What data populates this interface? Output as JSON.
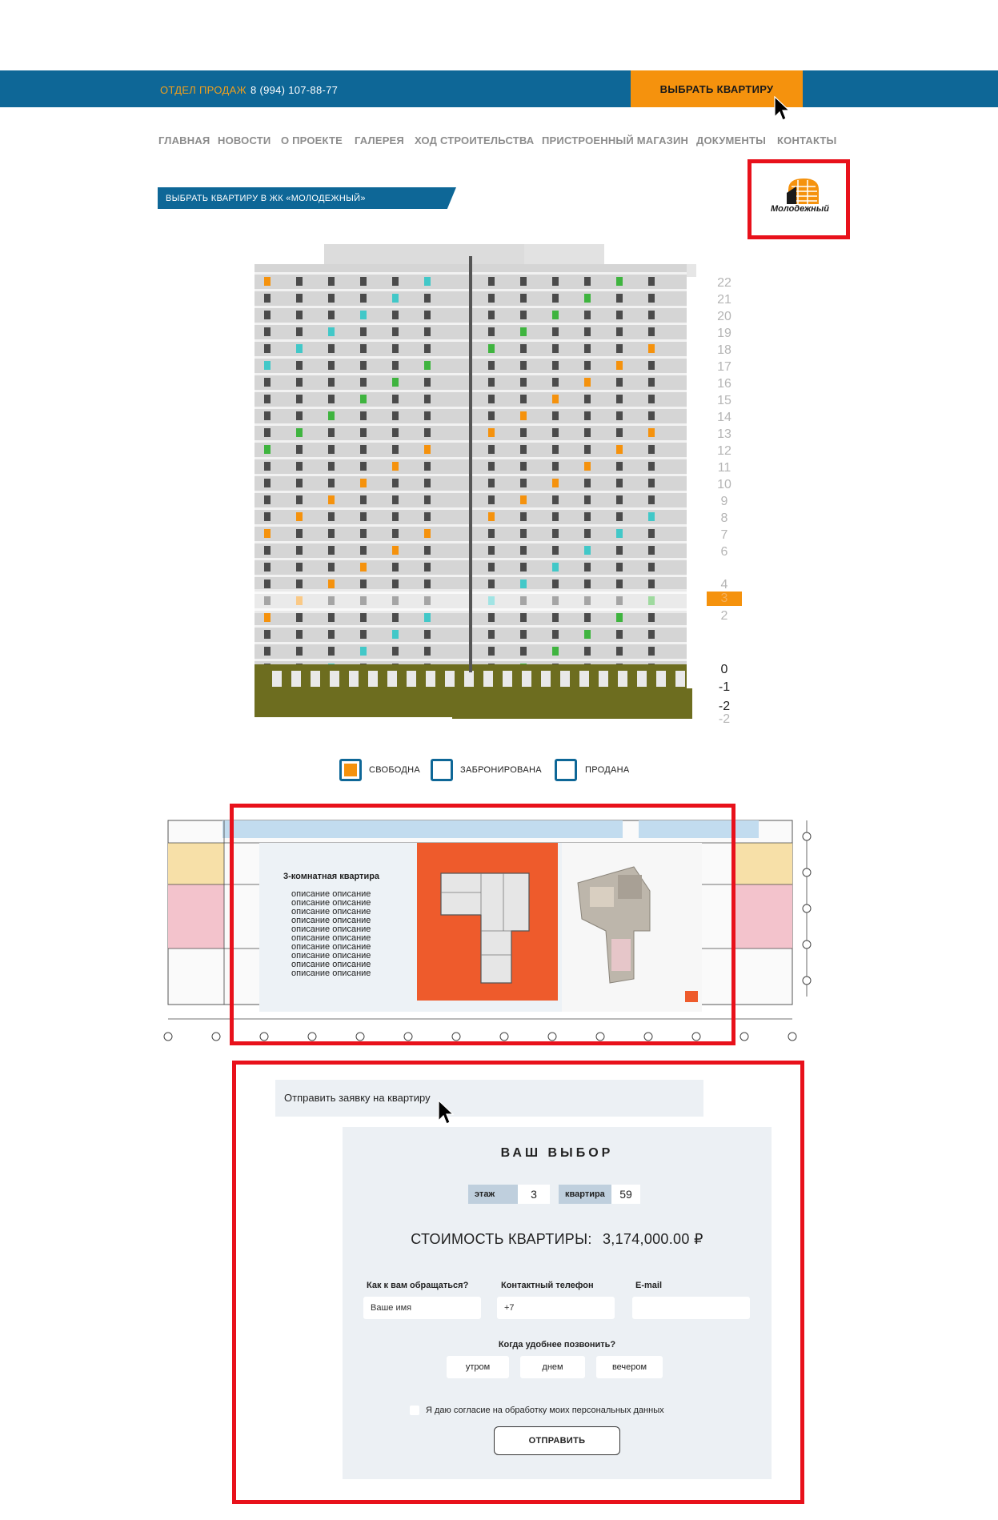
{
  "header": {
    "sales_label": "ОТДЕЛ ПРОДАЖ",
    "phone": "8 (994) 107-88-77",
    "cta_label": "ВЫБРАТЬ КВАРТИРУ"
  },
  "nav": {
    "items": [
      "ГЛАВНАЯ",
      "НОВОСТИ",
      "О ПРОЕКТЕ",
      "ГАЛЕРЕЯ",
      "ХОД СТРОИТЕЛЬСТВА",
      "ПРИСТРОЕННЫЙ МАГАЗИН",
      "ДОКУМЕНТЫ",
      "КОНТАКТЫ"
    ]
  },
  "section": {
    "badge": "ВЫБРАТЬ КВАРТИРУ В ЖК «МОЛОДЕЖНЫЙ»"
  },
  "logo": {
    "text": "Молодежный"
  },
  "floors": {
    "upper": [
      "22",
      "21",
      "20",
      "19",
      "18",
      "17",
      "16",
      "15",
      "14",
      "13",
      "12",
      "11",
      "10",
      "9",
      "8",
      "7",
      "6"
    ],
    "middle": [
      "4",
      "3",
      "2"
    ],
    "lower": [
      "0",
      "-1",
      "-2",
      "-2"
    ],
    "selected": "3"
  },
  "legend": {
    "free": "СВОБОДНА",
    "reserved": "ЗАБРОНИРОВАНА",
    "sold": "ПРОДАНА",
    "colors": {
      "free": "#f5920d",
      "frame": "#0e6797"
    }
  },
  "apartment_popup": {
    "title": "3-комнатная квартира",
    "description": [
      "описание описание",
      "описание описание",
      "описание описание",
      "описание описание",
      "описание описание",
      "описание описание",
      "описание описание",
      "описание описание",
      "описание описание",
      "описание описание"
    ]
  },
  "form": {
    "request_title": "Отправить заявку на квартиру",
    "choice_title": "ВАШ ВЫБОР",
    "floor_label": "этаж",
    "floor_value": "3",
    "apartment_label": "квартира",
    "apartment_value": "59",
    "price_label": "СТОИМОСТЬ КВАРТИРЫ:",
    "price_value": "3,174,000.00 ₽",
    "name_label": "Как к вам обращаться?",
    "name_placeholder": "Ваше имя",
    "phone_label": "Контактный телефон",
    "phone_placeholder": "+7",
    "email_label": "E-mail",
    "call_time_label": "Когда удобнее позвонить?",
    "times": [
      "утром",
      "днем",
      "вечером"
    ],
    "consent": "Я даю согласие на обработку моих персональных данных",
    "submit": "ОТПРАВИТЬ"
  },
  "colors": {
    "brand_blue": "#0e6797",
    "accent_orange": "#f5920d",
    "highlight_red": "#e8111b",
    "plan_orange": "#ee5b2c"
  }
}
